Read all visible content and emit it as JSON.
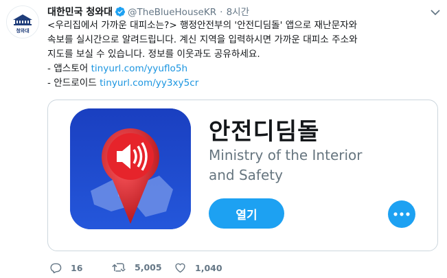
{
  "tweet": {
    "author_name": "대한민국 청와대",
    "handle": "@TheBlueHouseKR",
    "separator": "·",
    "time": "8시간",
    "avatar_text": "청와대",
    "body_lines": [
      "<우리집에서 가까운 대피소는?> 행정안전부의 '안전디딤돌' 앱으로 재난문자와",
      "속보를 실시간으로 알려드립니다. 계신 지역을 입력하시면 가까운 대피소 주소와",
      "지도를 보실 수 있습니다. 정보를 이웃과도 공유하세요."
    ],
    "links": [
      {
        "prefix": "- 앱스토어 ",
        "url": "tinyurl.com/yyuflo5h"
      },
      {
        "prefix": "- 안드로이드 ",
        "url": "tinyurl.com/yy3xy5cr"
      }
    ]
  },
  "card": {
    "app_name": "안전디딤돌",
    "subtitle": "Ministry of the Interior and Safety",
    "open_label": "열기",
    "more_icon": "more-icon"
  },
  "actions": {
    "reply_count": "16",
    "retweet_count": "5,005",
    "like_count": "1,040"
  },
  "colors": {
    "accent": "#1da1f2",
    "link": "#1b95e0",
    "muted": "#657786",
    "app_icon_bg": "#1d49c8",
    "pin_red": "#d61f26"
  }
}
